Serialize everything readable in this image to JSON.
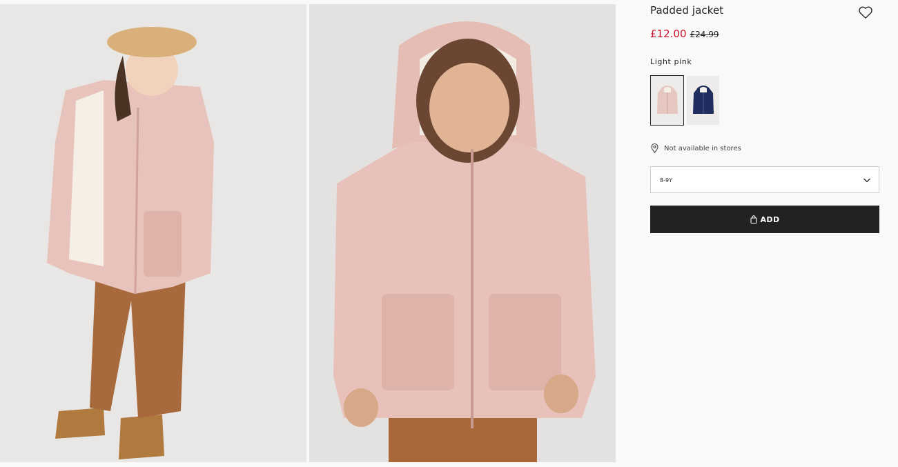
{
  "product": {
    "title": "Padded jacket",
    "price_now": "£12.00",
    "price_was": "£24.99",
    "color_name": "Light pink",
    "store_availability": "Not available in stores",
    "size_selected": "8-9Y",
    "add_label": "ADD"
  },
  "gallery": {
    "images": [
      {
        "subject": "child in light pink padded jacket, beret and corduroy trousers"
      },
      {
        "subject": "child in light pink padded jacket with hood, close-up"
      }
    ]
  },
  "swatches": [
    {
      "color": "Light pink",
      "hex": "#e6c7c0",
      "selected": true
    },
    {
      "color": "Dark blue",
      "hex": "#1f2e5e",
      "selected": false
    }
  ],
  "colors": {
    "sale_price": "#c8102e",
    "button_bg": "#222222",
    "jacket_pink": "#e8c2ba"
  },
  "icons": {
    "favourite": "heart-outline-icon",
    "store": "location-pin-icon",
    "dropdown": "chevron-down-icon",
    "bag": "shopping-bag-icon"
  }
}
